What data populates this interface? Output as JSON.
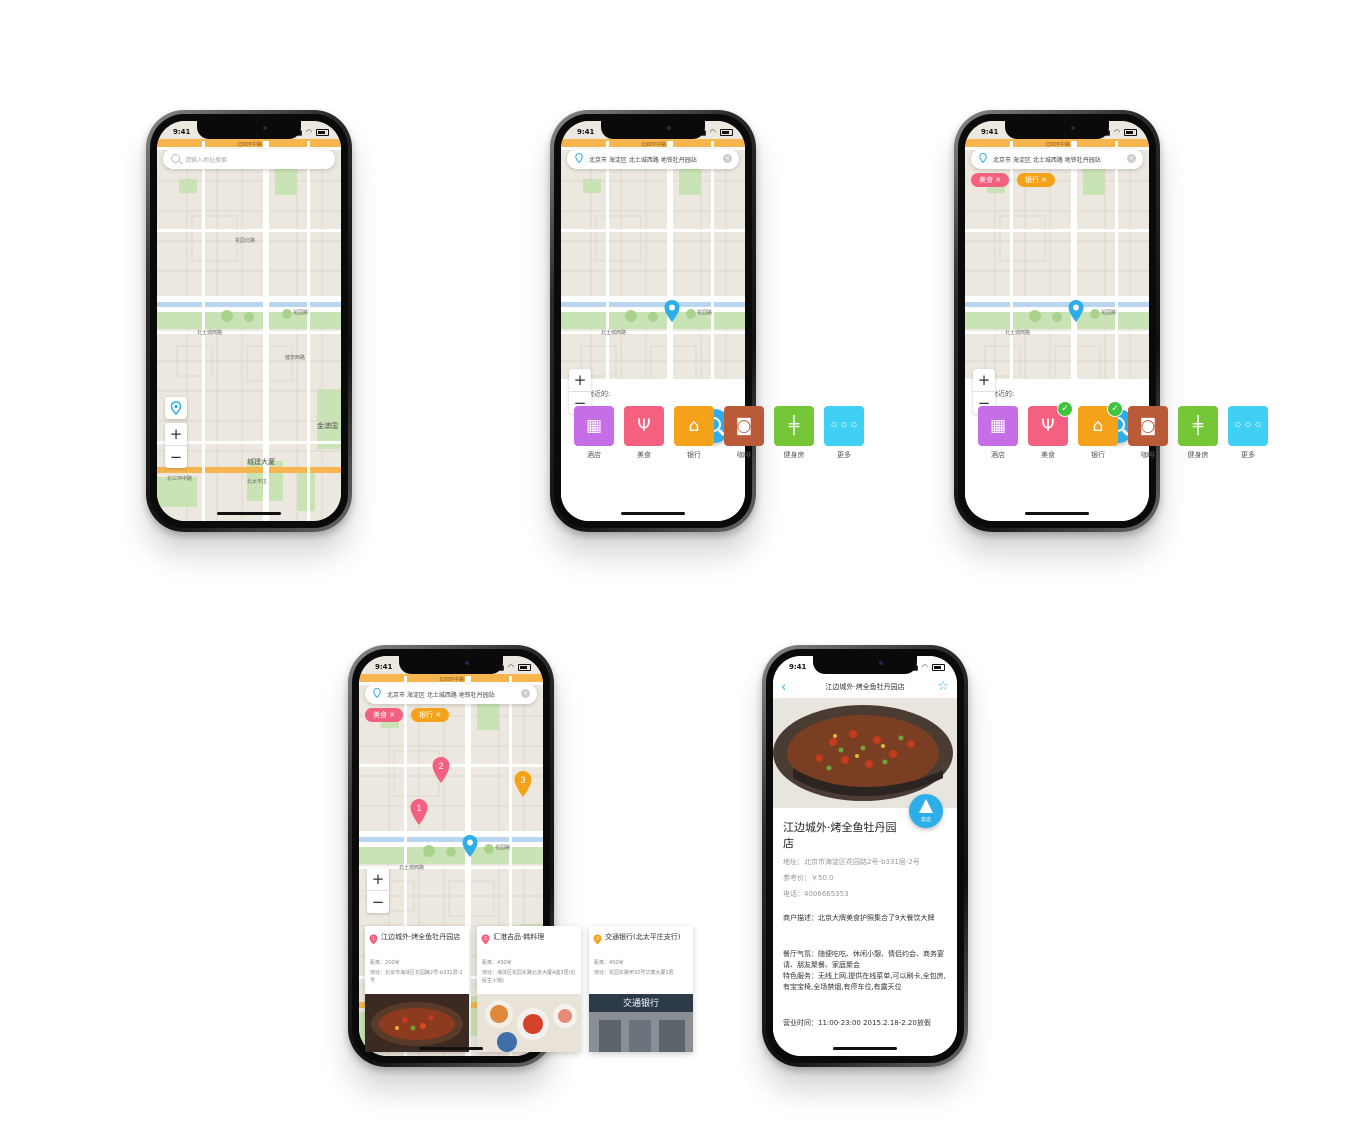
{
  "status_time": "9:41",
  "map_labels": {
    "ring_road": "北四环中路",
    "garden_road": "花园北路",
    "xueyuan": "学院南路",
    "garden": "花园路",
    "beitucheng": "北土城西路",
    "jianyuan": "健安西路",
    "beitaipingzhuang": "北太平庄路",
    "jintai": "金澳国",
    "chengjian": "城建大厦",
    "north_3rd_ring": "北三环中路",
    "beitaipingzhuang2": "北太平庄"
  },
  "screen1": {
    "search_placeholder": "请输入地址搜索"
  },
  "screen2": {
    "address": "北京市 海淀区 北土城西路 地铁牡丹园站",
    "panel_title": "搜索附近的:",
    "categories": [
      {
        "label": "酒店",
        "icon": "hotel-icon",
        "color": "#c56ee6"
      },
      {
        "label": "美食",
        "icon": "food-icon",
        "color": "#f4607f"
      },
      {
        "label": "银行",
        "icon": "bank-icon",
        "color": "#f5a21b"
      },
      {
        "label": "咖啡",
        "icon": "coffee-icon",
        "color": "#b95a39"
      },
      {
        "label": "健身房",
        "icon": "gym-icon",
        "color": "#76c737"
      },
      {
        "label": "更多",
        "icon": "more-icon",
        "color": "#40d0f4"
      }
    ]
  },
  "screen3": {
    "address": "北京市 海淀区 北土城西路 地铁牡丹园站",
    "chips": [
      {
        "label": "美食",
        "color": "#f4607f"
      },
      {
        "label": "银行",
        "color": "#f5a21b"
      }
    ],
    "panel_title": "搜索附近的:",
    "checked": [
      "美食",
      "银行"
    ]
  },
  "screen4": {
    "address": "北京市 海淀区 北土城西路 地铁牡丹园站",
    "chips": [
      {
        "label": "美食",
        "color": "#f4607f"
      },
      {
        "label": "银行",
        "color": "#f5a21b"
      }
    ],
    "pins": [
      "1",
      "2",
      "3"
    ],
    "cards": [
      {
        "num": "1",
        "color": "#f4607f",
        "name": "江边城外·烤全鱼牡丹园店",
        "dist": "距离：200米",
        "addr": "地址：北京市海淀区花园路2号-b331层-2号"
      },
      {
        "num": "2",
        "color": "#f4607f",
        "name": "汇港吉品·韩料理",
        "dist": "距离：430米",
        "addr": "地址：海淀区花园东路北京大厦A座3层(近民生火锅)"
      },
      {
        "num": "3",
        "color": "#f5a21b",
        "name": "交通银行(北太平庄支行)",
        "dist": "距离：450米",
        "addr": "地址：花园东路甲32号华康大厦1层"
      }
    ],
    "bank_sign": "交通银行"
  },
  "screen5": {
    "nav_title": "江边城外·烤全鱼牡丹园店",
    "go_label": "去这",
    "name": "江边城外·烤全鱼牡丹园店",
    "address": "地址：北京市海淀区花园路2号-b331层-2号",
    "price": "参考价：￥50.0",
    "phone": "电话：4006665353",
    "desc": "商户描述：北京大牌美食护照集合了9大餐饮大牌",
    "atmosphere": "餐厅气氛：随便吃吃、休闲小憩、情侣约会、商务宴请、朋友聚餐、家庭聚会",
    "services": "特色服务：无线上网,提供在线菜单,可以刷卡,全包房,有宝宝椅,全场禁烟,有停车位,有露天位",
    "hours": "营业时间：11:00-23:00 2015.2.18-2.20放假"
  }
}
